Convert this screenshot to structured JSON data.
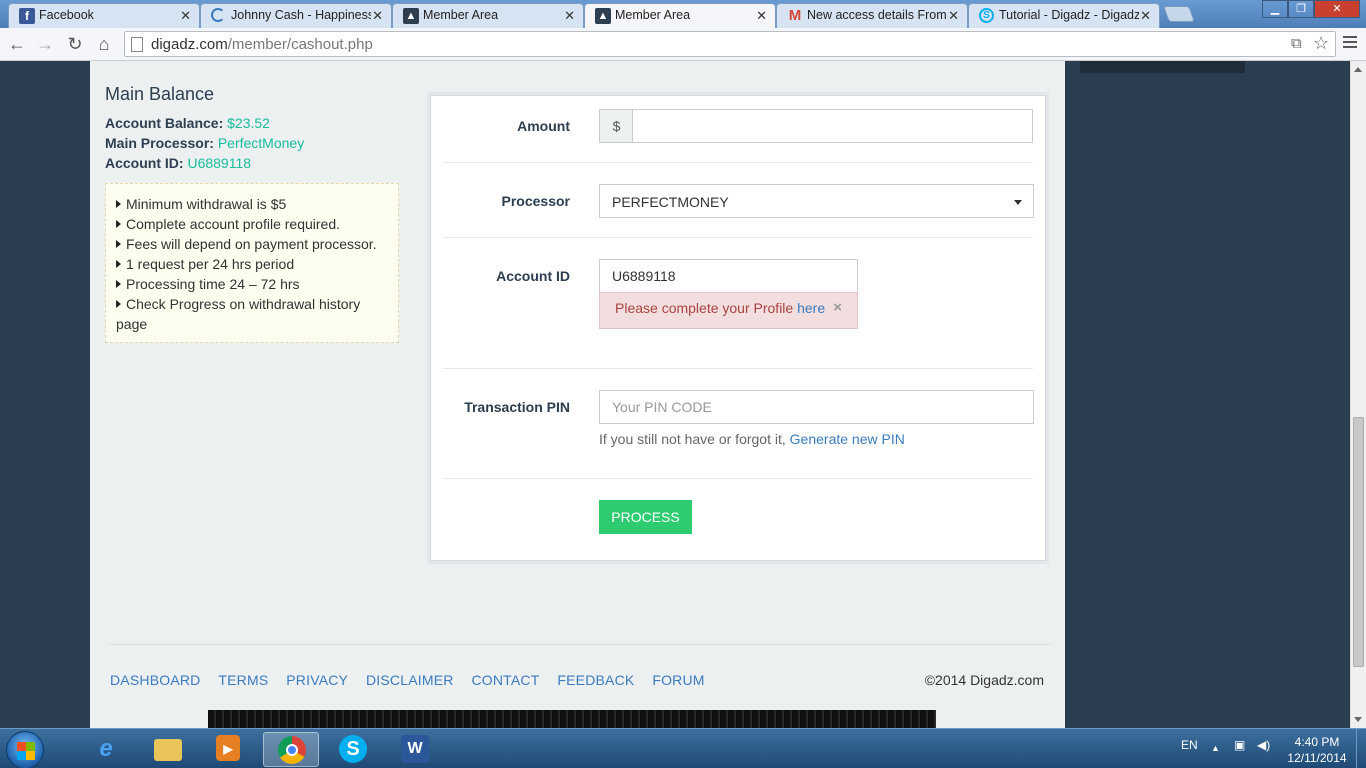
{
  "browser": {
    "tabs": [
      {
        "label": "Facebook",
        "icon": "facebook-icon",
        "color": "#3b5998",
        "active": false
      },
      {
        "label": "Johnny Cash - Happiness",
        "icon": "loading-spinner-icon",
        "color": "#3b7bbf",
        "active": false
      },
      {
        "label": "Member Area",
        "icon": "digadz-icon",
        "color": "#2c3e50",
        "active": false
      },
      {
        "label": "Member Area",
        "icon": "digadz-icon",
        "color": "#2c3e50",
        "active": true
      },
      {
        "label": "New access details From D",
        "icon": "gmail-icon",
        "color": "#d44638",
        "active": false
      },
      {
        "label": "Tutorial - Digadz - Digadz",
        "icon": "skype-s-icon",
        "color": "#00aff0",
        "active": false
      }
    ],
    "url_host": "digadz.com",
    "url_path": "/member/cashout.php"
  },
  "sidebar": {
    "title": "Main Balance",
    "balance_label": "Account Balance:",
    "balance_value": "$23.52",
    "processor_label": "Main Processor:",
    "processor_value": "PerfectMoney",
    "account_label": "Account ID:",
    "account_value": "U6889118",
    "notes": [
      "Minimum withdrawal is $5",
      "Complete account profile required.",
      "Fees will depend on payment processor.",
      "1 request per 24 hrs period",
      "Processing time 24 – 72 hrs",
      "Check Progress on withdrawal history page"
    ]
  },
  "form": {
    "amount_label": "Amount",
    "amount_addon": "$",
    "amount_value": "",
    "processor_label": "Processor",
    "processor_selected": "PERFECTMONEY",
    "account_id_label": "Account ID",
    "account_id_value": "U6889118",
    "alert_text": "Please complete your Profile",
    "alert_link": "here",
    "alert_close": "×",
    "pin_label": "Transaction PIN",
    "pin_placeholder": "Your PIN CODE",
    "pin_help": "If you still not have or forgot it,",
    "pin_help_link": "Generate new PIN",
    "submit_label": "PROCESS"
  },
  "footer": {
    "links": [
      "DASHBOARD",
      "TERMS",
      "PRIVACY",
      "DISCLAIMER",
      "CONTACT",
      "FEEDBACK",
      "FORUM"
    ],
    "copyright": "©2014 Digadz.com"
  },
  "taskbar": {
    "language": "EN",
    "time": "4:40 PM",
    "date": "12/11/2014",
    "apps": [
      "internet-explorer-icon",
      "file-explorer-icon",
      "media-player-icon",
      "chrome-icon",
      "skype-icon",
      "word-icon"
    ]
  },
  "colors": {
    "accent_green": "#18bc9c",
    "button_green": "#2ecc71",
    "link_blue": "#3b7bbf",
    "page_dark": "#2b3e50",
    "alert_bg": "#f2dede"
  }
}
